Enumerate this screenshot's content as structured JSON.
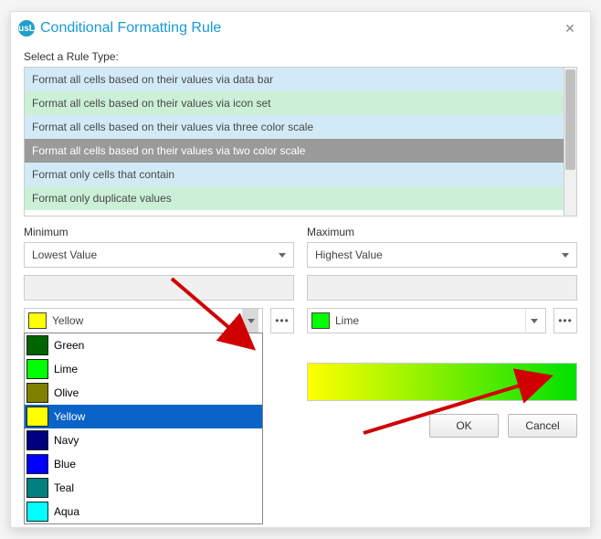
{
  "dialog": {
    "title": "Conditional Formatting Rule"
  },
  "ruleList": {
    "label": "Select a Rule Type:",
    "items": [
      "Format all cells based on their values via data bar",
      "Format all cells based on their values via icon set",
      "Format all cells based on their values via three color scale",
      "Format all cells based on their values via two color scale",
      "Format only cells that contain",
      "Format only duplicate values"
    ]
  },
  "minimum": {
    "label": "Minimum",
    "valueType": "Lowest Value",
    "colorName": "Yellow",
    "colorHex": "#ffff00"
  },
  "maximum": {
    "label": "Maximum",
    "valueType": "Highest Value",
    "colorName": "Lime",
    "colorHex": "#00ff00"
  },
  "colorPalette": [
    {
      "name": "Green",
      "hex": "#006400"
    },
    {
      "name": "Lime",
      "hex": "#00ff00"
    },
    {
      "name": "Olive",
      "hex": "#808000"
    },
    {
      "name": "Yellow",
      "hex": "#ffff00",
      "selected": true
    },
    {
      "name": "Navy",
      "hex": "#000080"
    },
    {
      "name": "Blue",
      "hex": "#0000ff"
    },
    {
      "name": "Teal",
      "hex": "#008080"
    },
    {
      "name": "Aqua",
      "hex": "#00ffff"
    }
  ],
  "buttons": {
    "ok": "OK",
    "cancel": "Cancel"
  }
}
